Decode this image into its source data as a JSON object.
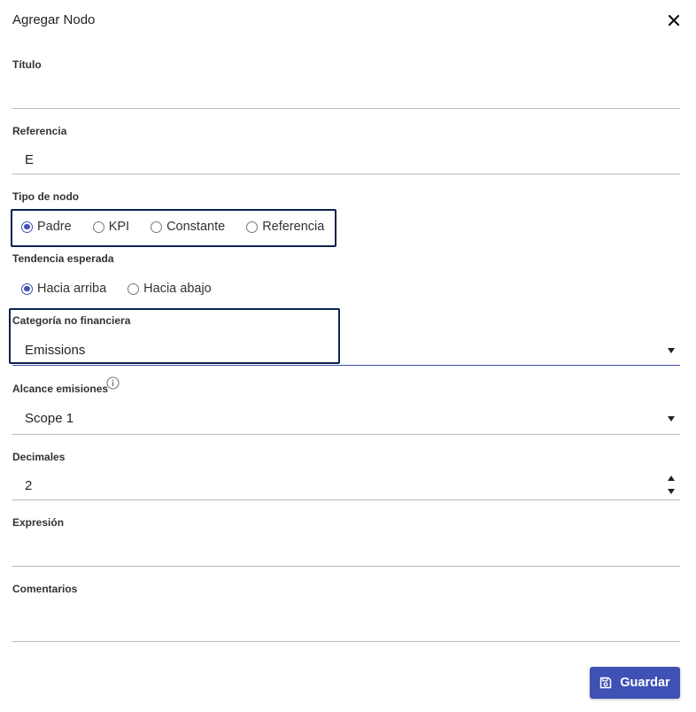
{
  "dialog": {
    "title": "Agregar Nodo",
    "close_icon": "close-icon"
  },
  "fields": {
    "titulo": {
      "label": "Título",
      "value": ""
    },
    "referencia": {
      "label": "Referencia",
      "value": "E"
    },
    "tipo_nodo": {
      "label": "Tipo de nodo",
      "options": [
        "Padre",
        "KPI",
        "Constante",
        "Referencia"
      ],
      "selected": "Padre"
    },
    "tendencia": {
      "label": "Tendencia esperada",
      "options": [
        "Hacia arriba",
        "Hacia abajo"
      ],
      "selected": "Hacia arriba"
    },
    "categoria": {
      "label": "Categoría no financiera",
      "value": "Emissions"
    },
    "alcance": {
      "label": "Alcance emisiones",
      "value": "Scope 1",
      "info_icon": "info-icon"
    },
    "decimales": {
      "label": "Decimales",
      "value": "2"
    },
    "expresion": {
      "label": "Expresión",
      "value": ""
    },
    "comentarios": {
      "label": "Comentarios",
      "value": ""
    }
  },
  "actions": {
    "save_label": "Guardar",
    "save_icon": "save-icon"
  },
  "colors": {
    "accent": "#3f51b5",
    "highlight": "#0b2250"
  }
}
